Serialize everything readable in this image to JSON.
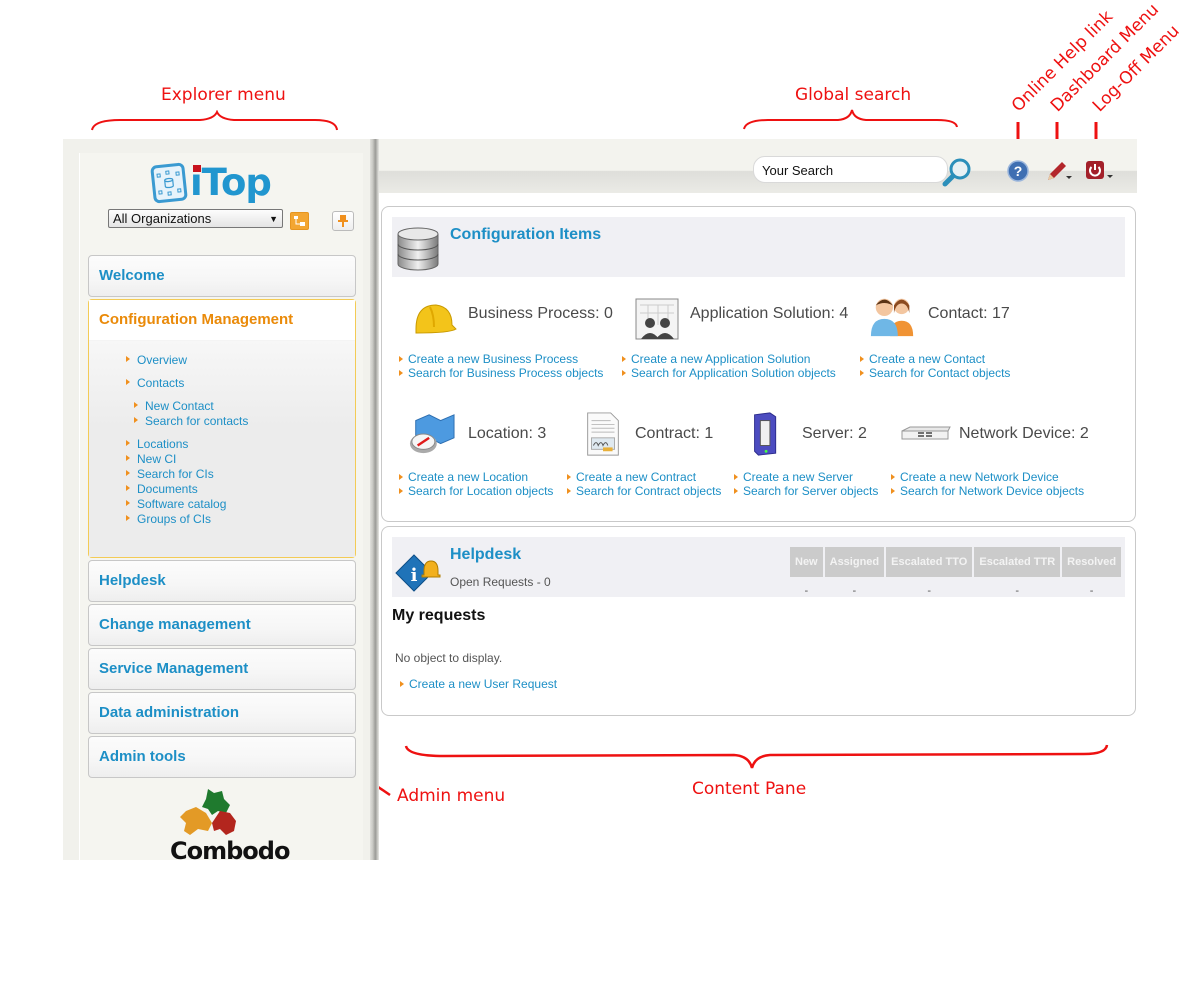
{
  "annotations": {
    "explorer_menu": "Explorer menu",
    "global_search": "Global search",
    "online_help_link": "Online Help link",
    "dashboard_menu": "Dashboard Menu",
    "logoff_menu": "Log-Off Menu",
    "admin_menu": "Admin menu",
    "content_pane": "Content Pane"
  },
  "colors": {
    "accent_blue": "#1d8fc6",
    "active_orange": "#ea8a09",
    "annotation_red": "#ee1111"
  },
  "sidebar": {
    "logo_text": "iTop",
    "org_select": {
      "selected": "All Organizations"
    },
    "org_tree_icon": "org-tree-icon",
    "pin_icon": "pin-icon",
    "menu": [
      {
        "label": "Welcome",
        "active": false
      },
      {
        "label": "Configuration Management",
        "active": true,
        "items": [
          {
            "label": "Overview"
          },
          {
            "label": "Contacts"
          },
          {
            "label": "New Contact",
            "level": 2
          },
          {
            "label": "Search for contacts",
            "level": 2
          },
          {
            "label": "Locations"
          },
          {
            "label": "New CI"
          },
          {
            "label": "Search for CIs"
          },
          {
            "label": "Documents"
          },
          {
            "label": "Software catalog"
          },
          {
            "label": "Groups of CIs"
          }
        ]
      },
      {
        "label": "Helpdesk",
        "active": false
      },
      {
        "label": "Change management",
        "active": false
      },
      {
        "label": "Service Management",
        "active": false
      },
      {
        "label": "Data administration",
        "active": false
      },
      {
        "label": "Admin tools",
        "active": false
      }
    ],
    "footer_logo": "Combodo"
  },
  "topbar": {
    "search": {
      "value": "Your Search",
      "placeholder": "Your Search"
    },
    "icons": [
      "search-icon",
      "help-icon",
      "dashboard-pencil-icon",
      "power-icon"
    ]
  },
  "config_items": {
    "title": "Configuration Items",
    "items": [
      {
        "label": "Business Process: 0",
        "name": "Business Process",
        "count": 0,
        "create": "Create a new Business Process",
        "search": "Search for Business Process objects"
      },
      {
        "label": "Application Solution: 4",
        "name": "Application Solution",
        "count": 4,
        "create": "Create a new Application Solution",
        "search": "Search for Application Solution objects"
      },
      {
        "label": "Contact: 17",
        "name": "Contact",
        "count": 17,
        "create": "Create a new Contact",
        "search": "Search for Contact objects"
      },
      {
        "label": "Location: 3",
        "name": "Location",
        "count": 3,
        "create": "Create a new Location",
        "search": "Search for Location objects"
      },
      {
        "label": "Contract: 1",
        "name": "Contract",
        "count": 1,
        "create": "Create a new Contract",
        "search": "Search for Contract objects"
      },
      {
        "label": "Server: 2",
        "name": "Server",
        "count": 2,
        "create": "Create a new Server",
        "search": "Search for Server objects"
      },
      {
        "label": "Network Device: 2",
        "name": "Network Device",
        "count": 2,
        "create": "Create a new Network Device",
        "search": "Search for Network Device objects"
      }
    ]
  },
  "helpdesk": {
    "title": "Helpdesk",
    "subtitle": "Open Requests - 0",
    "columns": [
      "New",
      "Assigned",
      "Escalated TTO",
      "Escalated TTR",
      "Resolved"
    ],
    "values": [
      "-",
      "-",
      "-",
      "-",
      "-"
    ],
    "my_requests_title": "My requests",
    "empty_text": "No object to display.",
    "create_link": "Create a new User Request"
  }
}
